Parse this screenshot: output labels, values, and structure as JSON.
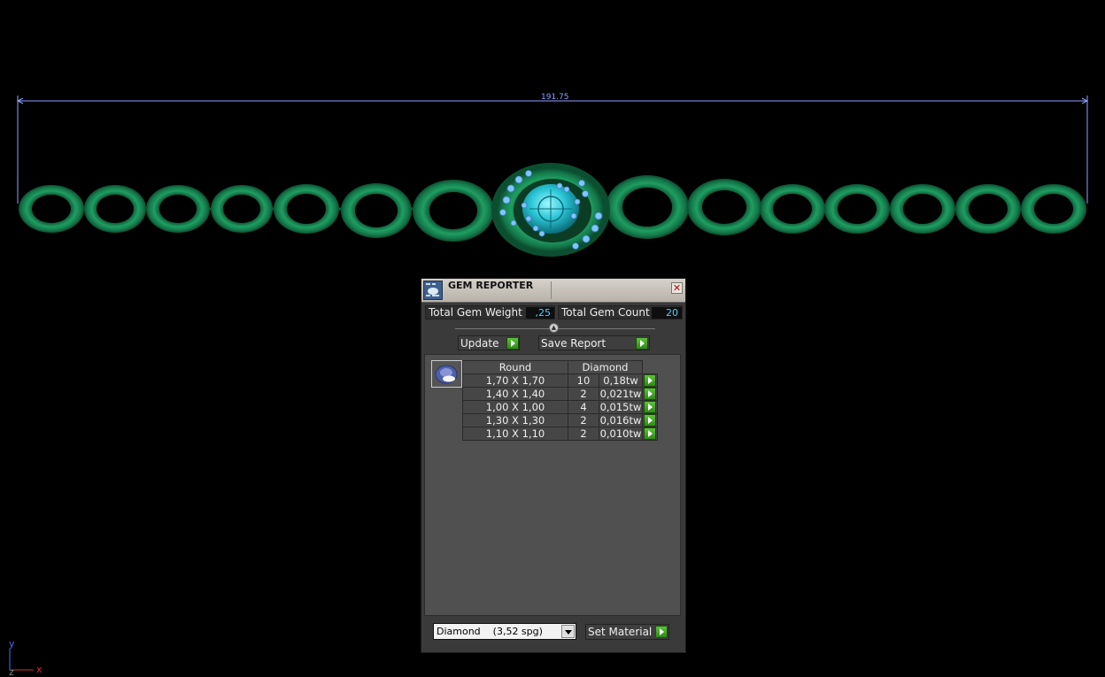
{
  "viewport": {
    "dimension_value": "191.75",
    "axis_y_label": "y",
    "axis_x_label": "x",
    "axis_z_label": "z"
  },
  "gem_reporter": {
    "title": "GEM REPORTER",
    "total_weight_label": "Total Gem Weight",
    "total_weight_value": ",25",
    "total_count_label": "Total Gem Count",
    "total_count_value": "20",
    "update_label": "Update",
    "save_report_label": "Save Report",
    "table": {
      "header_shape": "Round",
      "header_material": "Diamond",
      "rows": [
        {
          "size": "1,70 X 1,70",
          "count": "10",
          "weight": "0,18tw"
        },
        {
          "size": "1,40 X 1,40",
          "count": "2",
          "weight": "0,021tw"
        },
        {
          "size": "1,00 X 1,00",
          "count": "4",
          "weight": "0,015tw"
        },
        {
          "size": "1,30 X 1,30",
          "count": "2",
          "weight": "0,016tw"
        },
        {
          "size": "1,10 X 1,10",
          "count": "2",
          "weight": "0,010tw"
        }
      ]
    },
    "material_select_value": "Diamond    (3,52 spg)",
    "set_material_label": "Set Material"
  }
}
